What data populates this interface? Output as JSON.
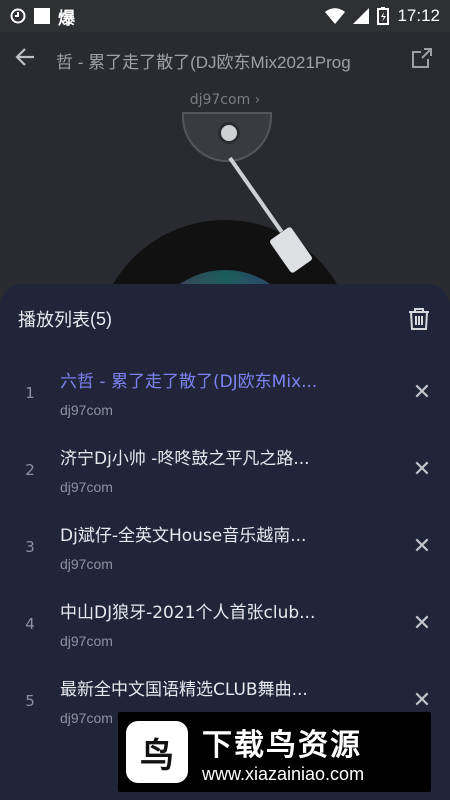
{
  "status_bar": {
    "time": "17:12",
    "icons": [
      "circle-icon",
      "square-icon",
      "fire-icon",
      "wifi-icon",
      "signal-icon",
      "battery-charging-icon"
    ],
    "left_text": "爆"
  },
  "header": {
    "title": "哲 - 累了走了散了(DJ欧东Mix2021Prog",
    "back_icon": "back-arrow-icon",
    "share_icon": "share-icon"
  },
  "artist_link": "dj97com ›",
  "playlist": {
    "title": "播放列表",
    "count": "(5)",
    "items": [
      {
        "index": "1",
        "song": "六哲 - 累了走了散了(DJ欧东Mix...",
        "artist": "dj97com",
        "active": true
      },
      {
        "index": "2",
        "song": "济宁Dj小帅 -咚咚鼓之平凡之路...",
        "artist": "dj97com",
        "active": false
      },
      {
        "index": "3",
        "song": "Dj斌仔-全英文House音乐越南...",
        "artist": "dj97com",
        "active": false
      },
      {
        "index": "4",
        "song": "中山DJ狼牙-2021个人首张club...",
        "artist": "dj97com",
        "active": false
      },
      {
        "index": "5",
        "song": "最新全中文国语精选CLUB舞曲...",
        "artist": "dj97com",
        "active": false
      }
    ],
    "remove_label": "✕"
  },
  "watermark": {
    "logo_char": "鸟",
    "text_cn": "下载鸟资源",
    "url": "www.xiazainiao.com"
  },
  "colors": {
    "accent": "#7b83f0",
    "panel_bg": "#20253a",
    "background": "#2a2b30"
  }
}
